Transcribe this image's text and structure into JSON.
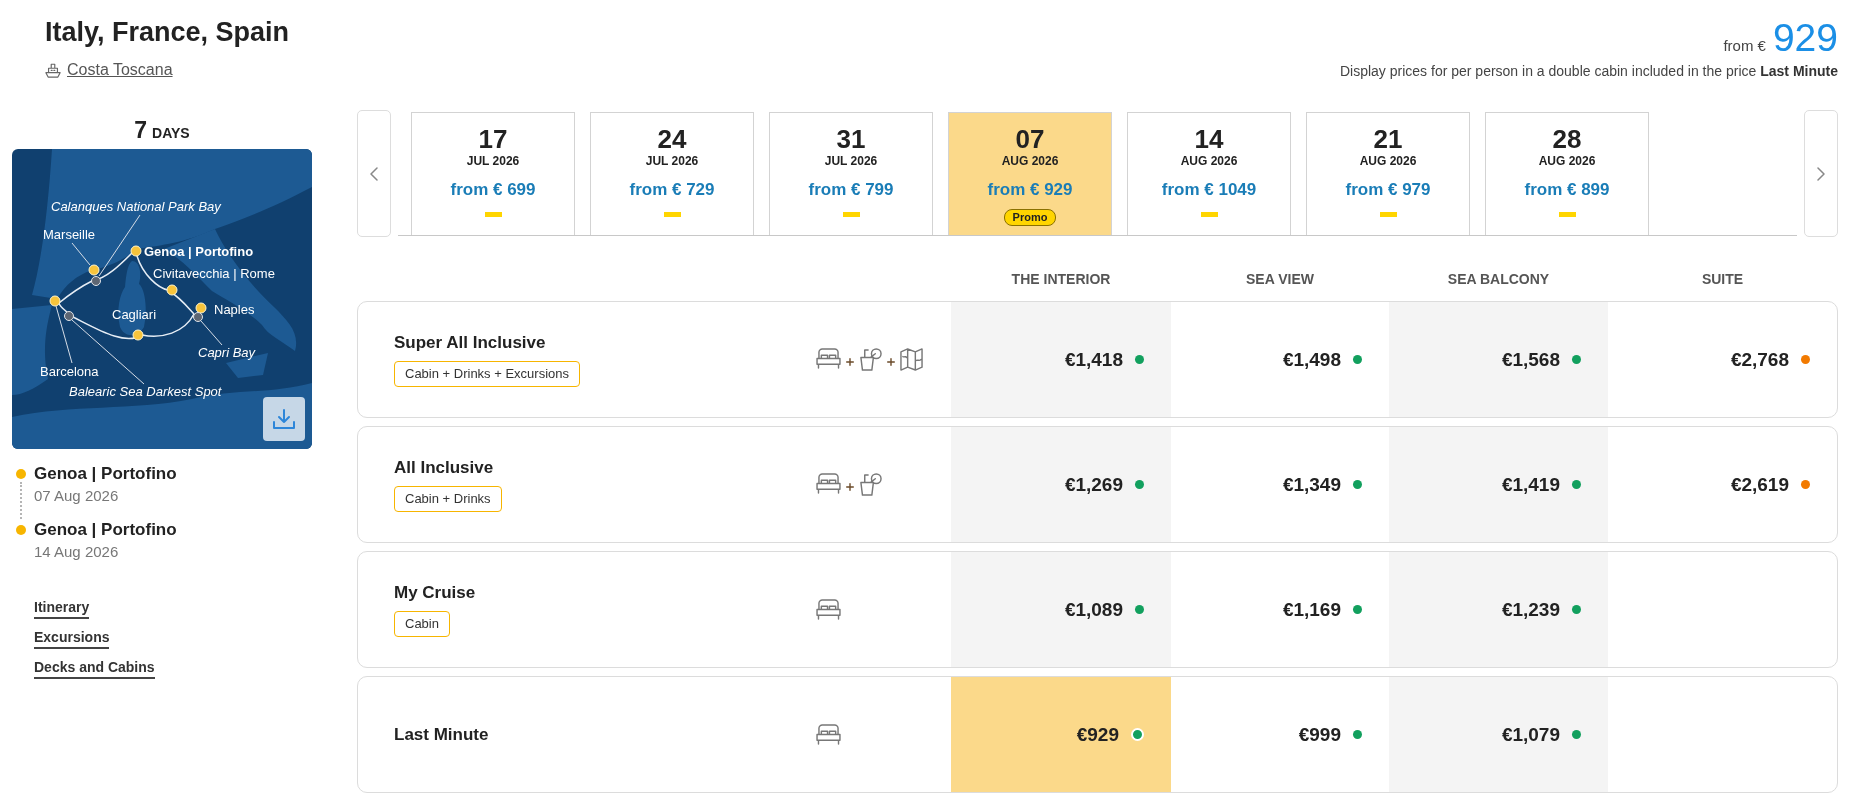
{
  "header": {
    "title": "Italy, France, Spain",
    "ship": "Costa Toscana",
    "price_prefix": "from €",
    "price": "929",
    "note": "Display prices for per person in a double cabin included in the price **Last Minute**"
  },
  "sidebar": {
    "duration_number": "7",
    "duration_unit": "DAYS",
    "map": {
      "labels": [
        {
          "text": "Calanques National Park Bay",
          "kind": "bay"
        },
        {
          "text": "Marseille",
          "kind": "port"
        },
        {
          "text": "Genoa | Portofino",
          "kind": "home_port"
        },
        {
          "text": "Civitavecchia | Rome",
          "kind": "port"
        },
        {
          "text": "Naples",
          "kind": "port"
        },
        {
          "text": "Cagliari",
          "kind": "port"
        },
        {
          "text": "Capri Bay",
          "kind": "bay"
        },
        {
          "text": "Barcelona",
          "kind": "port"
        },
        {
          "text": "Balearic Sea Darkest Spot",
          "kind": "bay"
        }
      ]
    },
    "itinerary": [
      {
        "port": "Genoa | Portofino",
        "date": "07 Aug 2026"
      },
      {
        "port": "Genoa | Portofino",
        "date": "14 Aug 2026"
      }
    ],
    "links": [
      "Itinerary",
      "Excursions",
      "Decks and Cabins"
    ]
  },
  "date_tabs": [
    {
      "day": "17",
      "month": "JUL 2026",
      "price": "from € 699",
      "selected": false
    },
    {
      "day": "24",
      "month": "JUL 2026",
      "price": "from € 729",
      "selected": false
    },
    {
      "day": "31",
      "month": "JUL 2026",
      "price": "from € 799",
      "selected": false
    },
    {
      "day": "07",
      "month": "AUG 2026",
      "price": "from € 929",
      "selected": true,
      "badge": "Promo"
    },
    {
      "day": "14",
      "month": "AUG 2026",
      "price": "from € 1049",
      "selected": false
    },
    {
      "day": "21",
      "month": "AUG 2026",
      "price": "from € 979",
      "selected": false
    },
    {
      "day": "28",
      "month": "AUG 2026",
      "price": "from € 899",
      "selected": false
    }
  ],
  "fares": {
    "columns": [
      "THE INTERIOR",
      "SEA VIEW",
      "SEA BALCONY",
      "SUITE"
    ],
    "rows": [
      {
        "name": "Super All Inclusive",
        "tag": "Cabin + Drinks + Excursions",
        "cabin_included": true,
        "drinks_included": true,
        "excursions_included": true,
        "prices": [
          {
            "price": "€1,418",
            "color": "#12a05e",
            "selected": false
          },
          {
            "price": "€1,498",
            "color": "#12a05e",
            "selected": false
          },
          {
            "price": "€1,568",
            "color": "#12a05e",
            "selected": false
          },
          {
            "price": "€2,768",
            "color": "#f27a00",
            "selected": false
          }
        ]
      },
      {
        "name": "All Inclusive",
        "tag": "Cabin + Drinks",
        "cabin_included": true,
        "drinks_included": true,
        "excursions_included": false,
        "prices": [
          {
            "price": "€1,269",
            "color": "#12a05e",
            "selected": false
          },
          {
            "price": "€1,349",
            "color": "#12a05e",
            "selected": false
          },
          {
            "price": "€1,419",
            "color": "#12a05e",
            "selected": false
          },
          {
            "price": "€2,619",
            "color": "#f27a00",
            "selected": false
          }
        ]
      },
      {
        "name": "My Cruise",
        "tag": "Cabin",
        "cabin_included": true,
        "drinks_included": false,
        "excursions_included": false,
        "prices": [
          {
            "price": "€1,089",
            "color": "#12a05e",
            "selected": false
          },
          {
            "price": "€1,169",
            "color": "#12a05e",
            "selected": false
          },
          {
            "price": "€1,239",
            "color": "#12a05e",
            "selected": false
          }
        ]
      },
      {
        "name": "Last Minute",
        "cabin_included": true,
        "drinks_included": false,
        "excursions_included": false,
        "prices": [
          {
            "price": "€929",
            "color": "#12a05e",
            "selected": true
          },
          {
            "price": "€999",
            "color": "#12a05e",
            "selected": false
          },
          {
            "price": "€1,079",
            "color": "#12a05e",
            "selected": false
          }
        ]
      }
    ]
  }
}
